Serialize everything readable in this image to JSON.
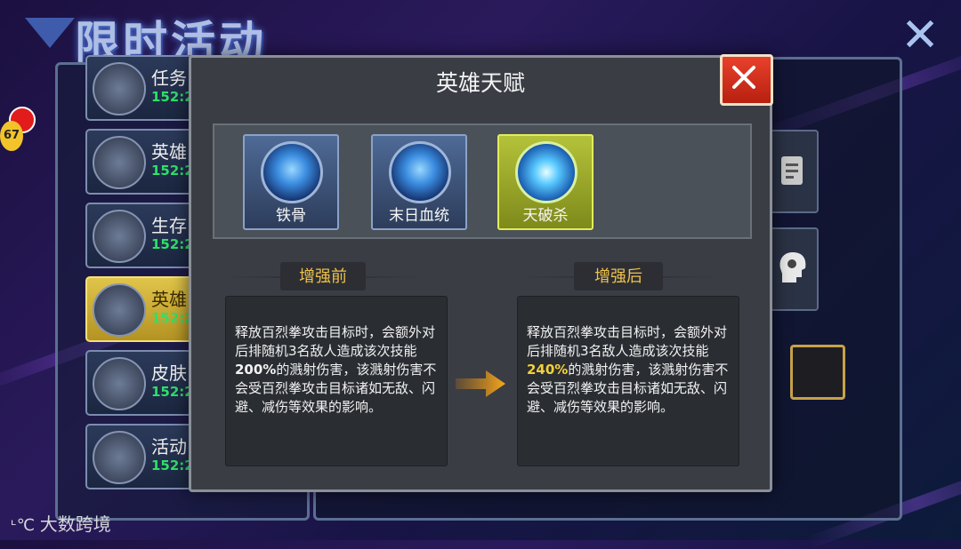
{
  "screen_title": "限时活动",
  "sidebar": {
    "badge_count": "67",
    "items": [
      {
        "name": "任务",
        "timer": "152:2"
      },
      {
        "name": "英雄",
        "timer": "152:2"
      },
      {
        "name": "生存",
        "timer": "152:2"
      },
      {
        "name": "英雄",
        "timer": "152:2"
      },
      {
        "name": "皮肤",
        "timer": "152:2"
      },
      {
        "name": "活动",
        "timer": "152:2"
      }
    ]
  },
  "modal": {
    "title": "英雄天赋",
    "tabs": [
      {
        "label": "铁骨"
      },
      {
        "label": "末日血统"
      },
      {
        "label": "天破杀"
      }
    ],
    "before": {
      "heading": "增强前",
      "text_a": "释放百烈拳攻击目标时，会额外对后排随机3名敌人造成该次技能",
      "value": "200%",
      "text_b": "的溅射伤害，该溅射伤害不会受百烈拳攻击目标诸如无敌、闪避、减伤等效果的影响。"
    },
    "after": {
      "heading": "增强后",
      "text_a": "释放百烈拳攻击目标时，会额外对后排随机3名敌人造成该次技能",
      "value": "240%",
      "text_b": "的溅射伤害，该溅射伤害不会受百烈拳攻击目标诸如无敌、闪避、减伤等效果的影响。"
    }
  },
  "watermark": "大数跨境",
  "colors": {
    "highlight": "#f3d03a",
    "accent_red": "#d0301a",
    "timer_green": "#2ee06a",
    "active_tab": "#b4c23a"
  }
}
